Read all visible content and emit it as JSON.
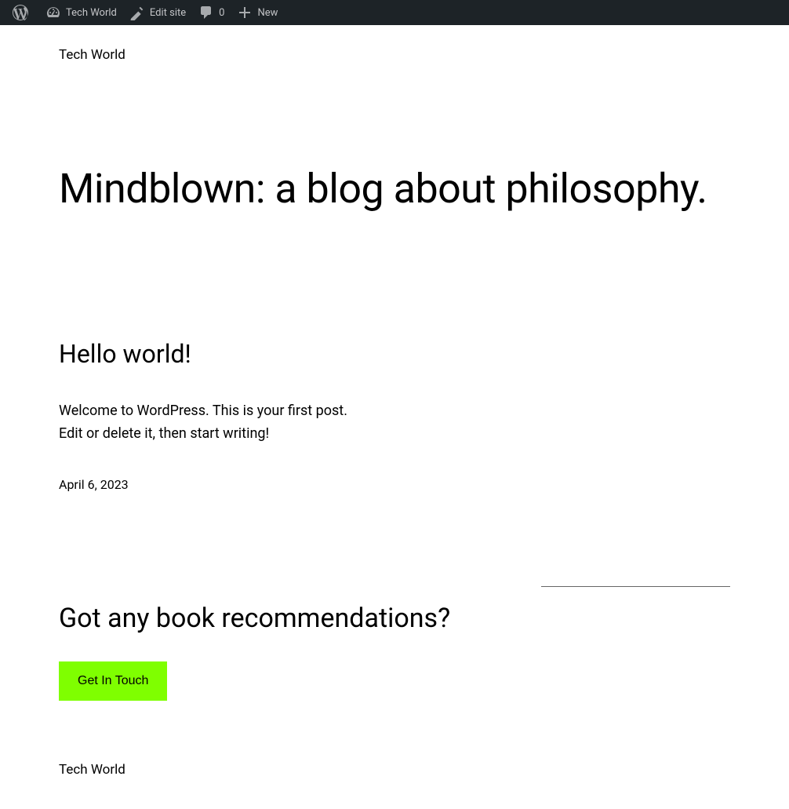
{
  "adminBar": {
    "siteName": "Tech World",
    "editSite": "Edit site",
    "commentsCount": "0",
    "newLabel": "New"
  },
  "header": {
    "siteTitle": "Tech World"
  },
  "main": {
    "heading": "Mindblown: a blog about philosophy."
  },
  "post": {
    "title": "Hello world!",
    "excerpt": "Welcome to WordPress. This is your first post. Edit or delete it, then start writing!",
    "date": "April 6, 2023"
  },
  "cta": {
    "heading": "Got any book recommendations?",
    "buttonLabel": "Get In Touch"
  },
  "footer": {
    "siteTitle": "Tech World"
  }
}
